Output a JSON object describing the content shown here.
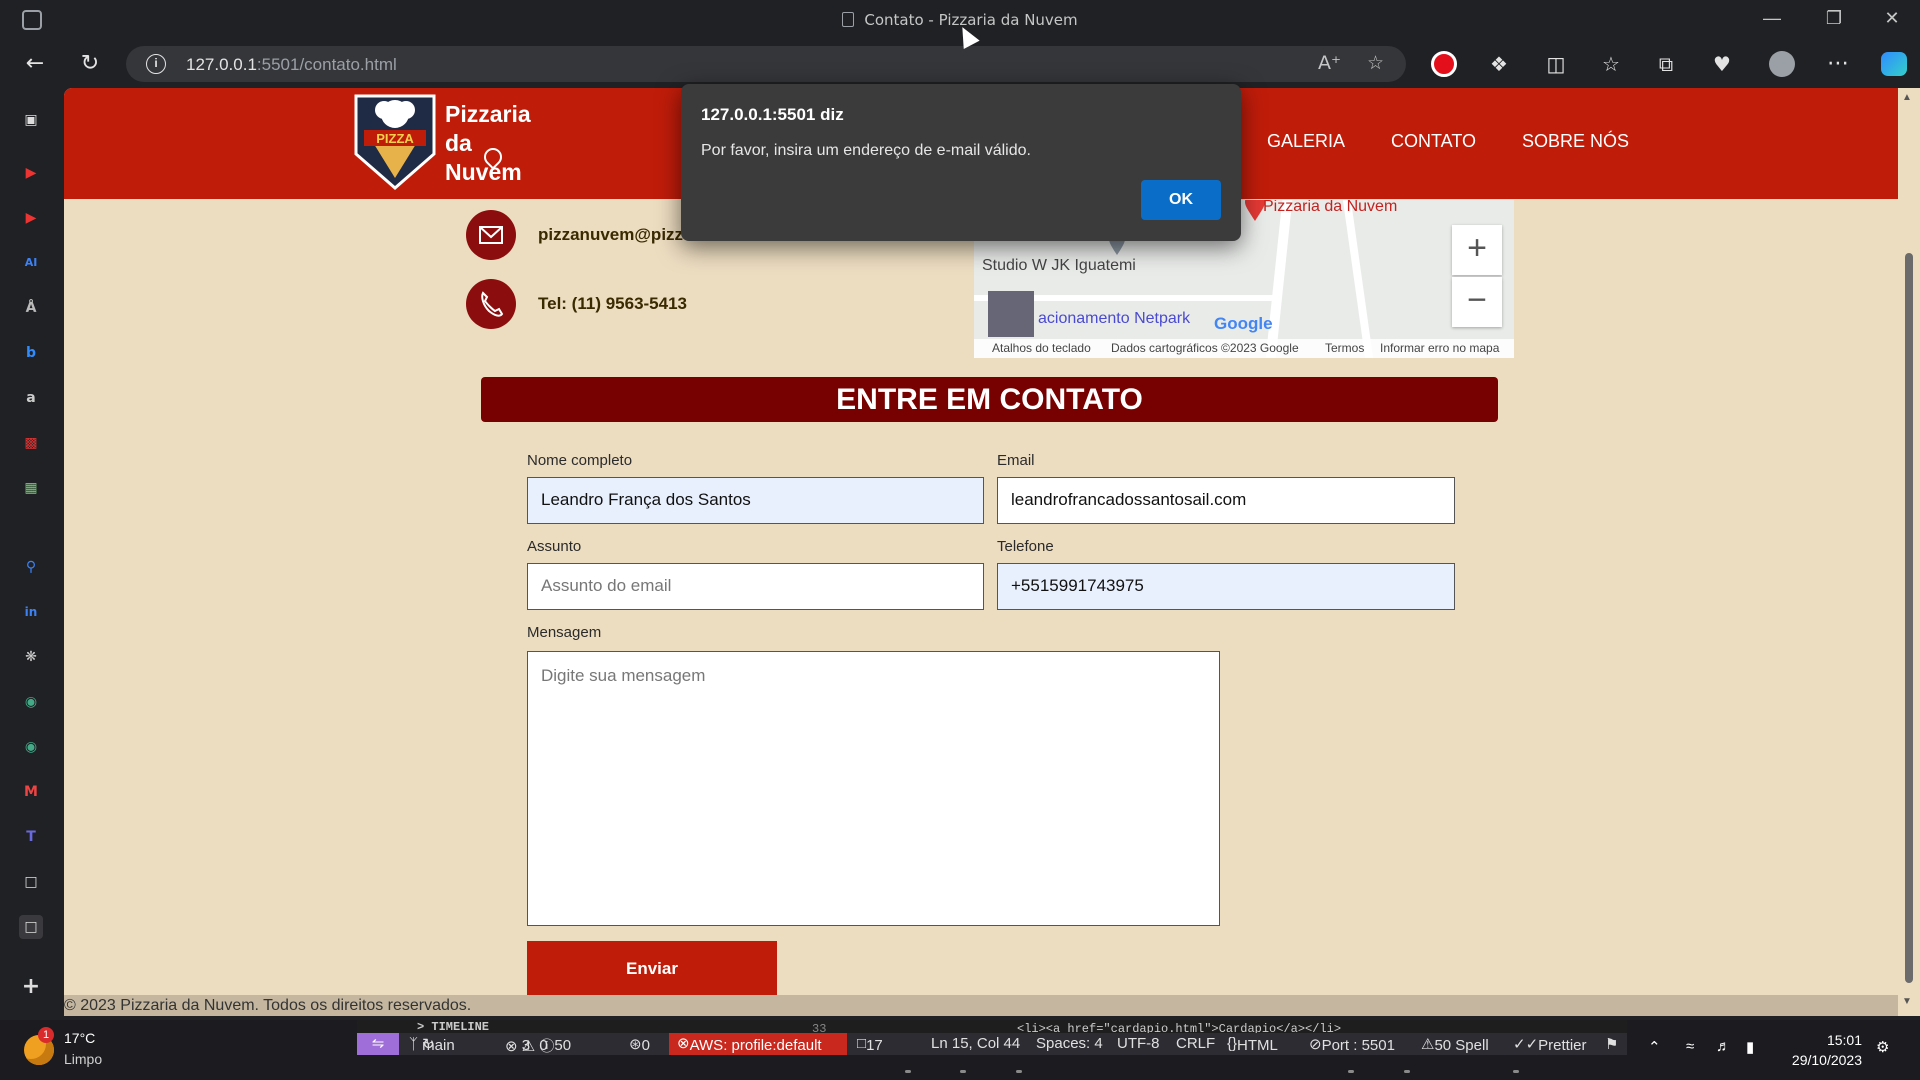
{
  "window": {
    "title": "Contato - Pizzaria da Nuvem"
  },
  "browser": {
    "url_host": "127.0.0.1",
    "url_rest": ":5501/contato.html"
  },
  "header": {
    "brand_line1": "Pizzaria",
    "brand_line2": "da",
    "brand_line3": "Nuvem",
    "logo_text": "PIZZA",
    "nav": [
      "GALERIA",
      "CONTATO",
      "SOBRE NÓS"
    ]
  },
  "contact": {
    "email": "pizzanuvem@pizza",
    "phone": "Tel: (11) 9563-5413"
  },
  "map": {
    "place": "Pizzaria da Nuvem",
    "poi1": "Studio W JK Iguatemi",
    "poi2": "acionamento Netpark",
    "brand": "Google",
    "footer": [
      "Atalhos do teclado",
      "Dados cartográficos ©2023 Google",
      "Termos",
      "Informar erro no mapa"
    ],
    "zoom_in": "+",
    "zoom_out": "−"
  },
  "form": {
    "title": "ENTRE EM CONTATO",
    "name_label": "Nome completo",
    "name_value": "Leandro França dos Santos",
    "email_label": "Email",
    "email_value": "leandrofrancadossantosail.com",
    "subject_label": "Assunto",
    "subject_placeholder": "Assunto do email",
    "phone_label": "Telefone",
    "phone_value": "+5515991743975",
    "message_label": "Mensagem",
    "message_placeholder": "Digite sua mensagem",
    "submit": "Enviar"
  },
  "footer": {
    "text": "© 2023 Pizzaria da Nuvem. Todos os direitos reservados."
  },
  "dialog": {
    "title": "127.0.0.1:5501 diz",
    "message": "Por favor, insira um endereço de e-mail válido.",
    "ok": "OK"
  },
  "taskbar": {
    "weather_badge": "1",
    "weather_temp": "17°C",
    "weather_desc": "Limpo",
    "vscode_code": "<li><a href=\"cardapio.html\">Cardapio</a></li>",
    "vscode_timeline": "> TIMELINE",
    "vscode_line_no": "33",
    "status": {
      "branch": "main",
      "errors": "3",
      "warnings": "0",
      "info": "50",
      "ports": "0",
      "aws": "AWS: profile:default",
      "files": "17",
      "cursor": "Ln 15, Col 44",
      "spaces": "Spaces: 4",
      "encoding": "UTF-8",
      "eol": "CRLF",
      "language": "HTML",
      "port": "Port : 5501",
      "spell": "50 Spell",
      "prettier": "Prettier"
    },
    "time": "15:01",
    "date": "29/10/2023"
  },
  "colors": {
    "header_red": "#c01c0a",
    "page_bg": "#ecdcc0",
    "title_bar": "#770000",
    "dialog_ok": "#0a6ec8"
  }
}
